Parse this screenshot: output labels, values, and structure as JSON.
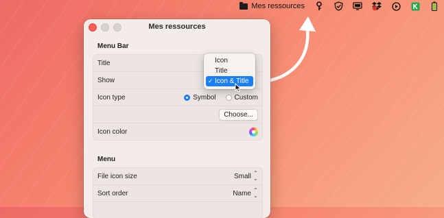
{
  "menubar": {
    "app_label": "Mes ressources",
    "icons": [
      "folder-icon",
      "key-icon",
      "shield-check-icon",
      "display-icon",
      "dropbox-icon",
      "play-circle-icon",
      "k-icon",
      "battery-icon"
    ]
  },
  "window": {
    "title": "Mes ressources",
    "sections": {
      "menu_bar": {
        "title": "Menu Bar",
        "title_label": "Title",
        "show_label": "Show",
        "icon_type_label": "Icon type",
        "icon_type_options": [
          "Symbol",
          "Custom"
        ],
        "icon_type_selected": "Symbol",
        "choose_button": "Choose...",
        "icon_color_label": "Icon color"
      },
      "menu": {
        "title": "Menu",
        "file_icon_size_label": "File icon size",
        "file_icon_size_value": "Small",
        "sort_order_label": "Sort order",
        "sort_order_value": "Name"
      }
    }
  },
  "popup": {
    "items": [
      "Icon",
      "Title",
      "Icon & Title"
    ],
    "selected": "Icon & Title",
    "check": "✓"
  },
  "colors": {
    "accent": "#1a7ef7",
    "close": "#fe5f57"
  }
}
